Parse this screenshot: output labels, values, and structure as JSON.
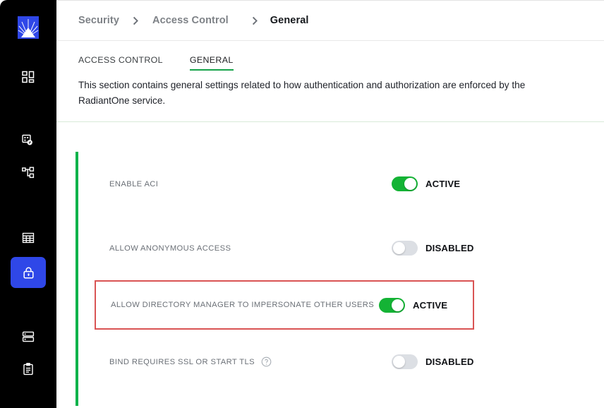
{
  "sidebar": {
    "logo": {
      "name": "radiantone-logo",
      "color": "#2f47e8"
    },
    "items": [
      {
        "icon": "dashboard-grid-icon",
        "name": "sidebar-item-dashboard",
        "active": false
      },
      {
        "icon": "datasource-link-icon",
        "name": "sidebar-item-data-sources",
        "active": false
      },
      {
        "icon": "hierarchy-tree-icon",
        "name": "sidebar-item-directory-namespace",
        "active": false
      },
      {
        "icon": "table-grid-icon",
        "name": "sidebar-item-data-catalog",
        "active": false
      },
      {
        "icon": "lock-icon",
        "name": "sidebar-item-security",
        "active": true
      },
      {
        "icon": "server-stack-icon",
        "name": "sidebar-item-servers",
        "active": false
      },
      {
        "icon": "clipboard-log-icon",
        "name": "sidebar-item-logs",
        "active": false
      }
    ]
  },
  "breadcrumb": {
    "items": [
      {
        "label": "Security",
        "current": false
      },
      {
        "label": "Access Control",
        "current": false
      },
      {
        "label": "General",
        "current": true
      }
    ],
    "separator": "chevron-right-icon"
  },
  "tabs": [
    {
      "label": "ACCESS CONTROL",
      "active": false
    },
    {
      "label": "GENERAL",
      "active": true
    }
  ],
  "description": "This section contains general settings related to how authentication and authorization are enforced by the RadiantOne service.",
  "settings": {
    "accent_color": "#0fb34b",
    "highlight_color": "#d95454",
    "rows": [
      {
        "label": "ENABLE ACI",
        "state": "ACTIVE",
        "on": true,
        "help": false,
        "highlighted": false
      },
      {
        "label": "ALLOW ANONYMOUS ACCESS",
        "state": "DISABLED",
        "on": false,
        "help": false,
        "highlighted": false
      },
      {
        "label": "ALLOW DIRECTORY MANAGER TO IMPERSONATE OTHER USERS",
        "state": "ACTIVE",
        "on": true,
        "help": false,
        "highlighted": true
      },
      {
        "label": "BIND REQUIRES SSL OR START TLS",
        "state": "DISABLED",
        "on": false,
        "help": true,
        "highlighted": false
      }
    ]
  }
}
